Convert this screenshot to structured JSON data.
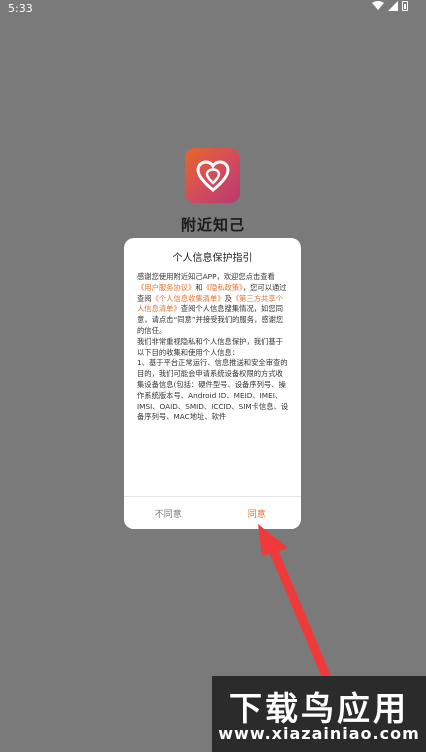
{
  "status": {
    "time": "5:33"
  },
  "app": {
    "name": "附近知己"
  },
  "dialog": {
    "title": "个人信息保护指引",
    "p1_a": "感谢您使用附近知己APP，欢迎您点击查看",
    "link_user_agreement": "《用户服务协议》",
    "p1_and": "和",
    "link_privacy_policy": "《隐私政策》",
    "p1_b": "，您可以通过查阅",
    "link_info_list": "《个人信息收集清单》",
    "p1_c": "及",
    "link_third_party_list": "《第三方共享个人信息清单》",
    "p1_d": "查阅个人信息搜集情况，如您同意，请点击“同意”并接受我们的服务，感谢您的信任。",
    "p2": "我们非常重视隐私和个人信息保护，我们基于以下目的收集和使用个人信息：",
    "p3": "1、基于平台正常运行、信息推送和安全审查的目的，我们可能会申请系统设备权限的方式收集设备信息(包括：硬件型号、设备序列号、操作系统版本号、Android ID、MEID、IMEI、IMSI、OAID、SMID、ICCID、SIM卡信息、设备序列号、MAC地址、软件",
    "disagree_label": "不同意",
    "agree_label": "同意"
  },
  "watermark": {
    "title": "下载鸟应用",
    "url": "www.xiazainiao.com"
  },
  "colors": {
    "accent": "#e8732e",
    "arrow": "#f03a3a",
    "overlay": "#7a7a7a"
  }
}
